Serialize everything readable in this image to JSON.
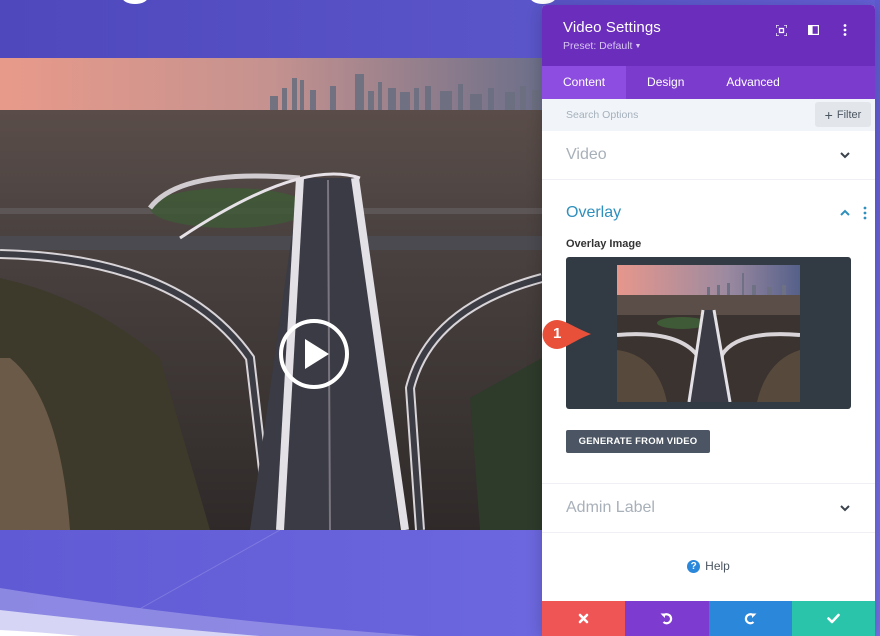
{
  "panel": {
    "title": "Video Settings",
    "preset_label": "Preset: Default",
    "header_icons": [
      "expand-icon",
      "sidebar-layout-icon",
      "more-options-icon"
    ],
    "tabs": [
      {
        "label": "Content",
        "active": true
      },
      {
        "label": "Design",
        "active": false
      },
      {
        "label": "Advanced",
        "active": false
      }
    ],
    "search": {
      "placeholder": "Search Options",
      "value": ""
    },
    "filter_label": "Filter",
    "sections": {
      "video": {
        "title": "Video",
        "expanded": false
      },
      "overlay": {
        "title": "Overlay",
        "expanded": true,
        "field_label": "Overlay Image",
        "generate_label": "GENERATE FROM VIDEO"
      },
      "admin_label": {
        "title": "Admin Label",
        "expanded": false
      }
    },
    "help_label": "Help",
    "footer": {
      "discard": "discard-icon",
      "undo": "undo-icon",
      "redo": "redo-icon",
      "save": "save-check-icon"
    }
  },
  "video": {
    "play_icon": "play-icon"
  },
  "callout": {
    "number": "1"
  },
  "colors": {
    "header": "#6a2dbc",
    "tabs": "#7b3ccd",
    "active_tab": "#8c4de0",
    "open_section": "#2f8fbd",
    "discard": "#ef5555",
    "undo": "#7e3bd0",
    "redo": "#2b87da",
    "save": "#29c4a9",
    "callout": "#e8503a"
  }
}
